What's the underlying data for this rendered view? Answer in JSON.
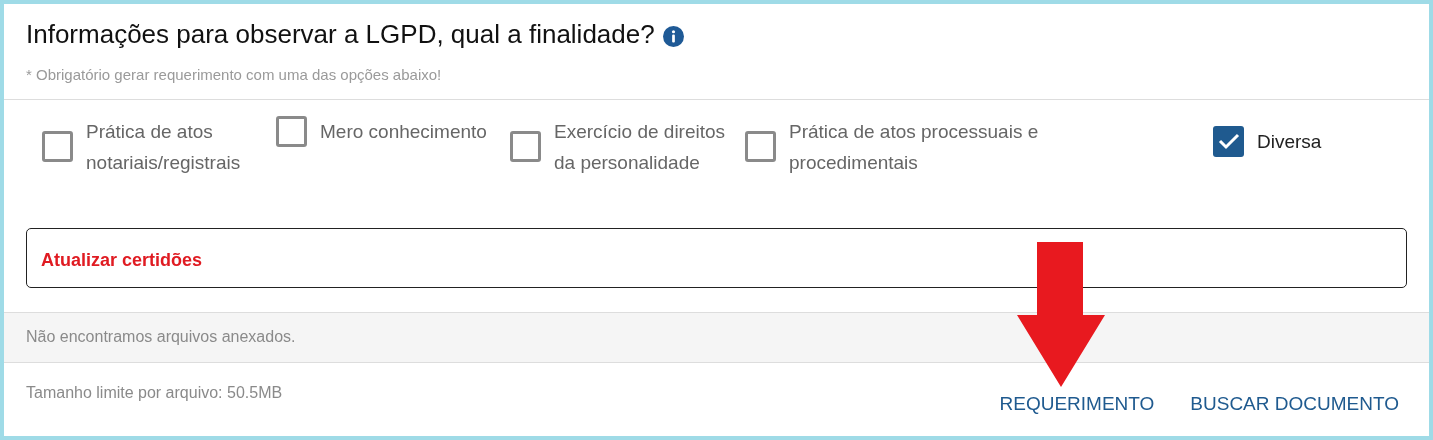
{
  "title": "Informações para observar a LGPD, qual a finalidade?",
  "subtitle": "* Obrigatório gerar requerimento com uma das opções abaixo!",
  "options": [
    {
      "label": "Prática de atos notariais/registrais",
      "checked": false
    },
    {
      "label": "Mero conhecimento",
      "checked": false
    },
    {
      "label": "Exercício de direitos da personalidade",
      "checked": false
    },
    {
      "label": "Prática de atos processuais e procedimentais",
      "checked": false
    },
    {
      "label": "Diversa",
      "checked": true
    }
  ],
  "purpose_field": {
    "value": "Atualizar certidões"
  },
  "attachments": {
    "empty_message": "Não encontramos arquivos anexados."
  },
  "footer": {
    "size_limit": "Tamanho limite por arquivo: 50.5MB",
    "buttons": [
      "REQUERIMENTO",
      "BUSCAR DOCUMENTO"
    ]
  }
}
